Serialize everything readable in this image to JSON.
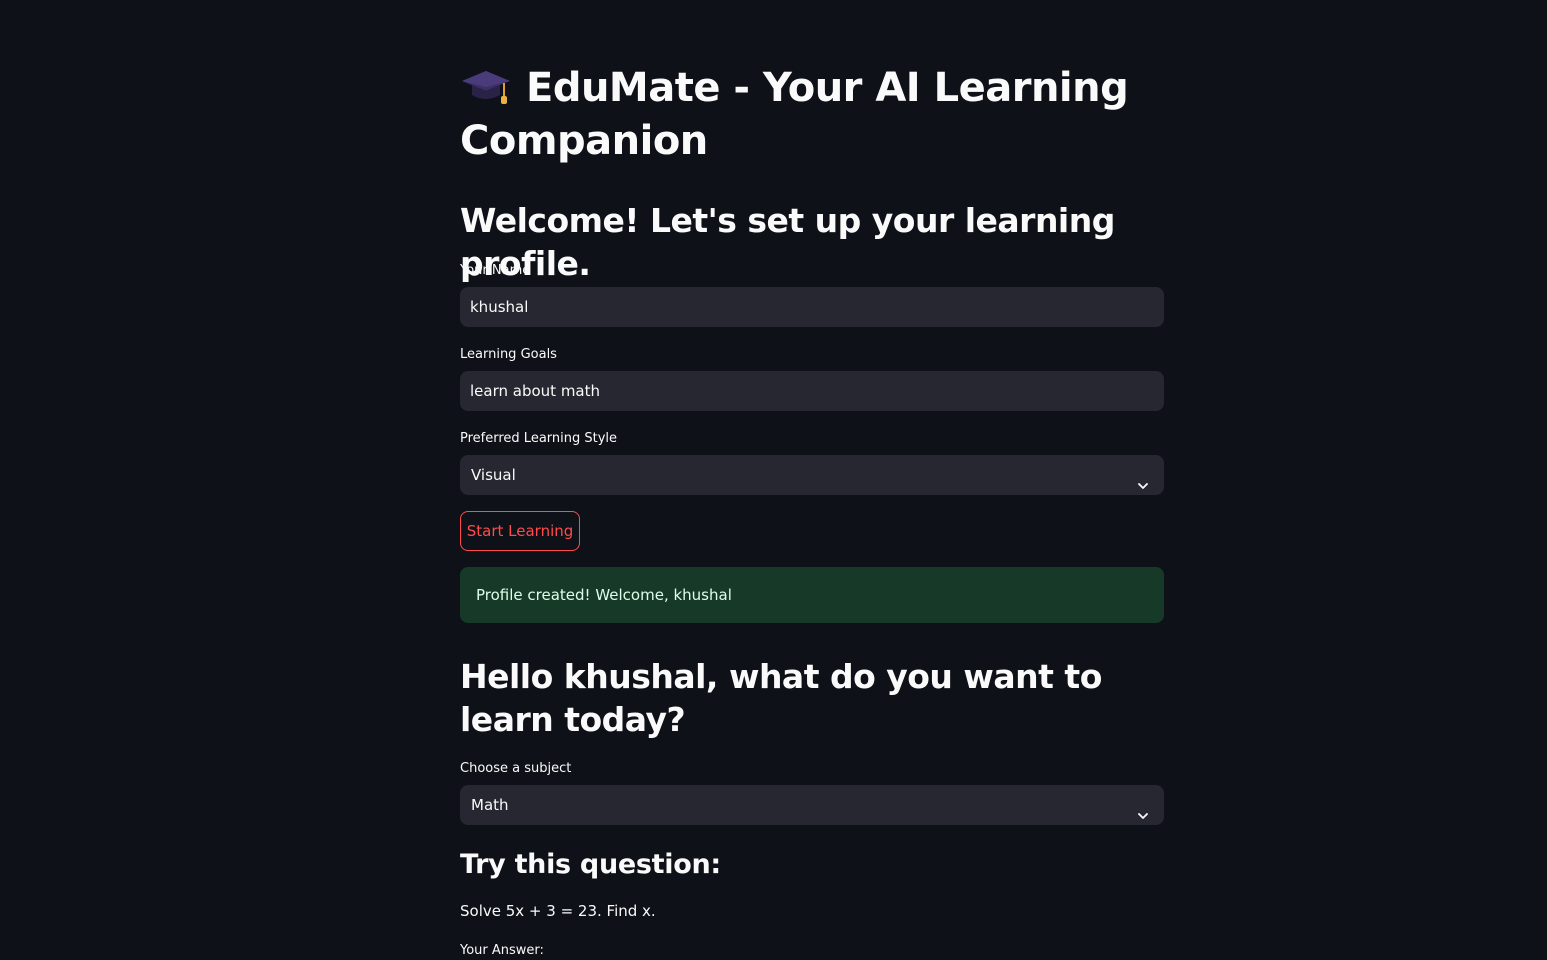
{
  "app": {
    "title": "EduMate - Your AI Learning Companion",
    "title_icon": "graduation-cap-icon",
    "accent_color": "#ff4b4b"
  },
  "profile": {
    "heading": "Welcome! Let's set up your learning profile.",
    "name_label": "Your Name",
    "name_value": "khushal",
    "goals_label": "Learning Goals",
    "goals_value": "learn about math",
    "style_label": "Preferred Learning Style",
    "style_value": "Visual",
    "start_button": "Start Learning",
    "success_message": "Profile created! Welcome, khushal"
  },
  "learn": {
    "heading": "Hello khushal, what do you want to learn today?",
    "subject_label": "Choose a subject",
    "subject_value": "Math",
    "question_heading": "Try this question:",
    "question_text": "Solve 5x + 3 = 23. Find x.",
    "answer_label": "Your Answer:"
  }
}
